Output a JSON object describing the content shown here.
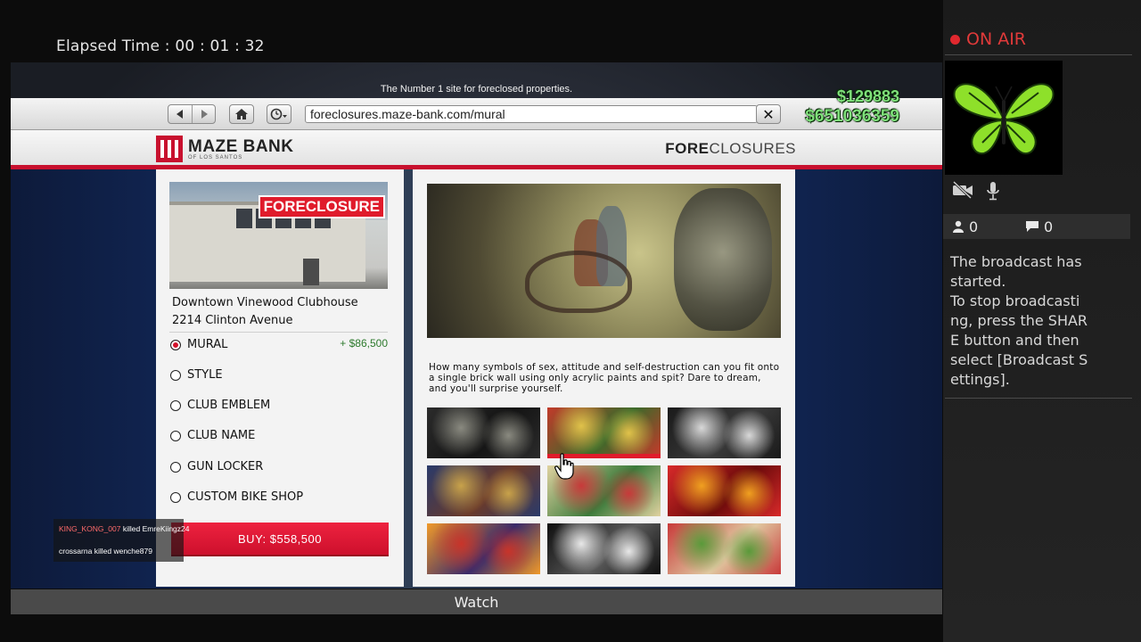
{
  "stream": {
    "elapsed_label": "Elapsed Time :",
    "elapsed_value": "00 : 01 : 32",
    "watch_label": "Watch"
  },
  "sidebar": {
    "on_air": "ON AIR",
    "viewers": "0",
    "comments": "0",
    "message": "The broadcast has\nstarted.\nTo stop broadcasti\nng, press the SHAR\nE button and then\nselect [Broadcast S\nettings]."
  },
  "hud": {
    "cash": "$129883",
    "bank": "$651036359"
  },
  "browser": {
    "tagline": "The Number 1 site for foreclosed properties.",
    "url": "foreclosures.maze-bank.com/mural",
    "close_symbol": "✕"
  },
  "site": {
    "brand_name": "MAZE BANK",
    "brand_sub": "OF LOS SANTOS",
    "section_bold": "FORE",
    "section_rest": "CLOSURES"
  },
  "property": {
    "stamp": "FORECLOSURE",
    "name": "Downtown Vinewood Clubhouse",
    "address": "2214 Clinton Avenue",
    "options": [
      {
        "label": "MURAL",
        "selected": true,
        "price": "+ $86,500"
      },
      {
        "label": "STYLE",
        "selected": false
      },
      {
        "label": "CLUB EMBLEM",
        "selected": false
      },
      {
        "label": "CLUB NAME",
        "selected": false
      },
      {
        "label": "GUN LOCKER",
        "selected": false
      },
      {
        "label": "CUSTOM BIKE SHOP",
        "selected": false
      }
    ],
    "buy_label": "BUY: $558,500"
  },
  "mural": {
    "description": "How many symbols of sex, attitude and self-destruction can you fit onto a single brick wall using only acrylic paints and spit? Dare to dream, and you'll surprise yourself.",
    "selected_index": 1,
    "thumbnails": [
      {
        "name": "mural-thumb-grim",
        "colors": [
          "#2b2b2b",
          "#8a8a80",
          "#141414"
        ]
      },
      {
        "name": "mural-thumb-biker",
        "colors": [
          "#c23a2a",
          "#e0c24a",
          "#3a6a2a"
        ]
      },
      {
        "name": "mural-thumb-skull",
        "colors": [
          "#1a1a1a",
          "#d8d8d8",
          "#3a3a3a"
        ]
      },
      {
        "name": "mural-thumb-crowd",
        "colors": [
          "#2a3a6a",
          "#c8a24a",
          "#6a3a2a"
        ]
      },
      {
        "name": "mural-thumb-party",
        "colors": [
          "#e0d2a0",
          "#c83a3a",
          "#3a7a3a"
        ]
      },
      {
        "name": "mural-thumb-city-red",
        "colors": [
          "#d82a2a",
          "#f0a020",
          "#6a0a0a"
        ]
      },
      {
        "name": "mural-thumb-sunset",
        "colors": [
          "#f09a2a",
          "#c8342a",
          "#3a2a6a"
        ]
      },
      {
        "name": "mural-thumb-bw",
        "colors": [
          "#0f0f0f",
          "#e8e8e8",
          "#5a5a5a"
        ]
      },
      {
        "name": "mural-thumb-green-skull",
        "colors": [
          "#c83a3a",
          "#5a9a3a",
          "#e0c8a0"
        ]
      }
    ]
  },
  "killfeed": [
    {
      "killer": "KING_KONG_007",
      "verb": "killed",
      "victim": "EmreKiingz24"
    },
    {
      "killer": "crossarna",
      "verb": "killed",
      "victim": "wenche879"
    }
  ],
  "colors": {
    "accent_red": "#c8102e",
    "money_green": "#7fe07a",
    "on_air_red": "#e03a3a"
  }
}
